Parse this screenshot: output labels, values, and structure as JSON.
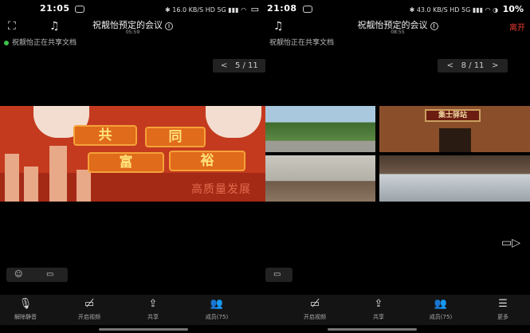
{
  "left": {
    "status": {
      "time": "21:05",
      "net_rate": "16.0 KB/S",
      "hd": "HD",
      "net": "5G"
    },
    "header": {
      "title": "祝靓怡预定的会议",
      "info_glyph": "i",
      "timer": "05:59"
    },
    "share_note": "祝靓怡正在共享文档",
    "pager": {
      "prev": "<",
      "current": "5",
      "total": "11"
    },
    "slide_caption": "高质量发展",
    "slide_blocks": [
      "共",
      "同",
      "富",
      "裕"
    ],
    "bottom_bar": [
      {
        "icon": "mic-muted-icon",
        "label": "解除静音"
      },
      {
        "icon": "camera-off-icon",
        "label": "开启视频"
      },
      {
        "icon": "share-icon",
        "label": "共享"
      },
      {
        "icon": "members-icon",
        "label": "成员(75)"
      }
    ]
  },
  "right": {
    "status": {
      "time": "21:08",
      "net_rate": "43.0 KB/S",
      "hd": "HD",
      "net": "5G",
      "battery": "10%"
    },
    "header": {
      "title": "祝靓怡预定的会议",
      "info_glyph": "i",
      "timer": "08:55",
      "leave": "离开"
    },
    "share_note": "祝靓怡正在共享文档",
    "pager": {
      "prev": "<",
      "current": "8",
      "total": "11",
      "next": ">"
    },
    "sign_text": "集士驿站",
    "bottom_bar": [
      {
        "icon": "camera-off-icon",
        "label": "开启视频"
      },
      {
        "icon": "share-icon",
        "label": "共享"
      },
      {
        "icon": "members-icon",
        "label": "成员(75)"
      },
      {
        "icon": "menu-icon",
        "label": "更多"
      }
    ]
  }
}
